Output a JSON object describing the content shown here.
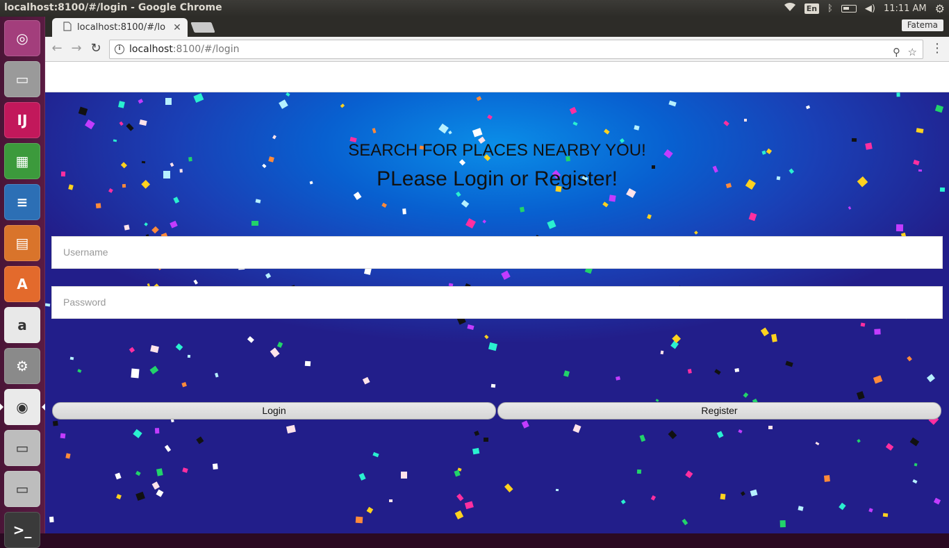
{
  "os_panel": {
    "window_title": "localhost:8100/#/login - Google Chrome",
    "keyboard_layout": "En",
    "clock": "11:11 AM",
    "icons": [
      "wifi-icon",
      "keyboard-layout-indicator",
      "bluetooth-icon",
      "battery-icon",
      "volume-icon",
      "settings-gear-icon"
    ]
  },
  "launcher": {
    "items": [
      {
        "name": "ubuntu-dash",
        "glyph": "◎",
        "color": "#a33e7c"
      },
      {
        "name": "files",
        "glyph": "▭",
        "color": "#9a9a9a"
      },
      {
        "name": "intellij-idea",
        "glyph": "IJ",
        "color": "#c2185b"
      },
      {
        "name": "libreoffice-calc",
        "glyph": "▦",
        "color": "#3c9a3c"
      },
      {
        "name": "libreoffice-writer",
        "glyph": "≡",
        "color": "#2c6fb5"
      },
      {
        "name": "libreoffice-impress",
        "glyph": "▤",
        "color": "#d9742b"
      },
      {
        "name": "ubuntu-software",
        "glyph": "A",
        "color": "#e36a2c"
      },
      {
        "name": "amazon",
        "glyph": "a",
        "color": "#e8e8e8"
      },
      {
        "name": "system-settings",
        "glyph": "⚙",
        "color": "#8a8a8a"
      },
      {
        "name": "google-chrome",
        "glyph": "◉",
        "color": "#eaeaea"
      },
      {
        "name": "disk-drive",
        "glyph": "▭",
        "color": "#bdbdbd"
      },
      {
        "name": "disk-drive-2",
        "glyph": "▭",
        "color": "#bdbdbd"
      },
      {
        "name": "terminal",
        "glyph": ">_",
        "color": "#3a3a3a"
      }
    ]
  },
  "browser": {
    "tab_title": "localhost:8100/#/lo",
    "profile_name": "Fatema",
    "url_host": "localhost",
    "url_rest": ":8100/#/login"
  },
  "login": {
    "headline": "SEARCH FOR PLACES NEARBY YOU!",
    "subheadline": "PLease Login or Register!",
    "username_placeholder": "Username",
    "password_placeholder": "Password",
    "login_label": "Login",
    "register_label": "Register"
  },
  "colors": {
    "hero_center": "#0a8ee8",
    "hero_edge": "#221e8a",
    "launcher_bg": "#4a1537"
  }
}
